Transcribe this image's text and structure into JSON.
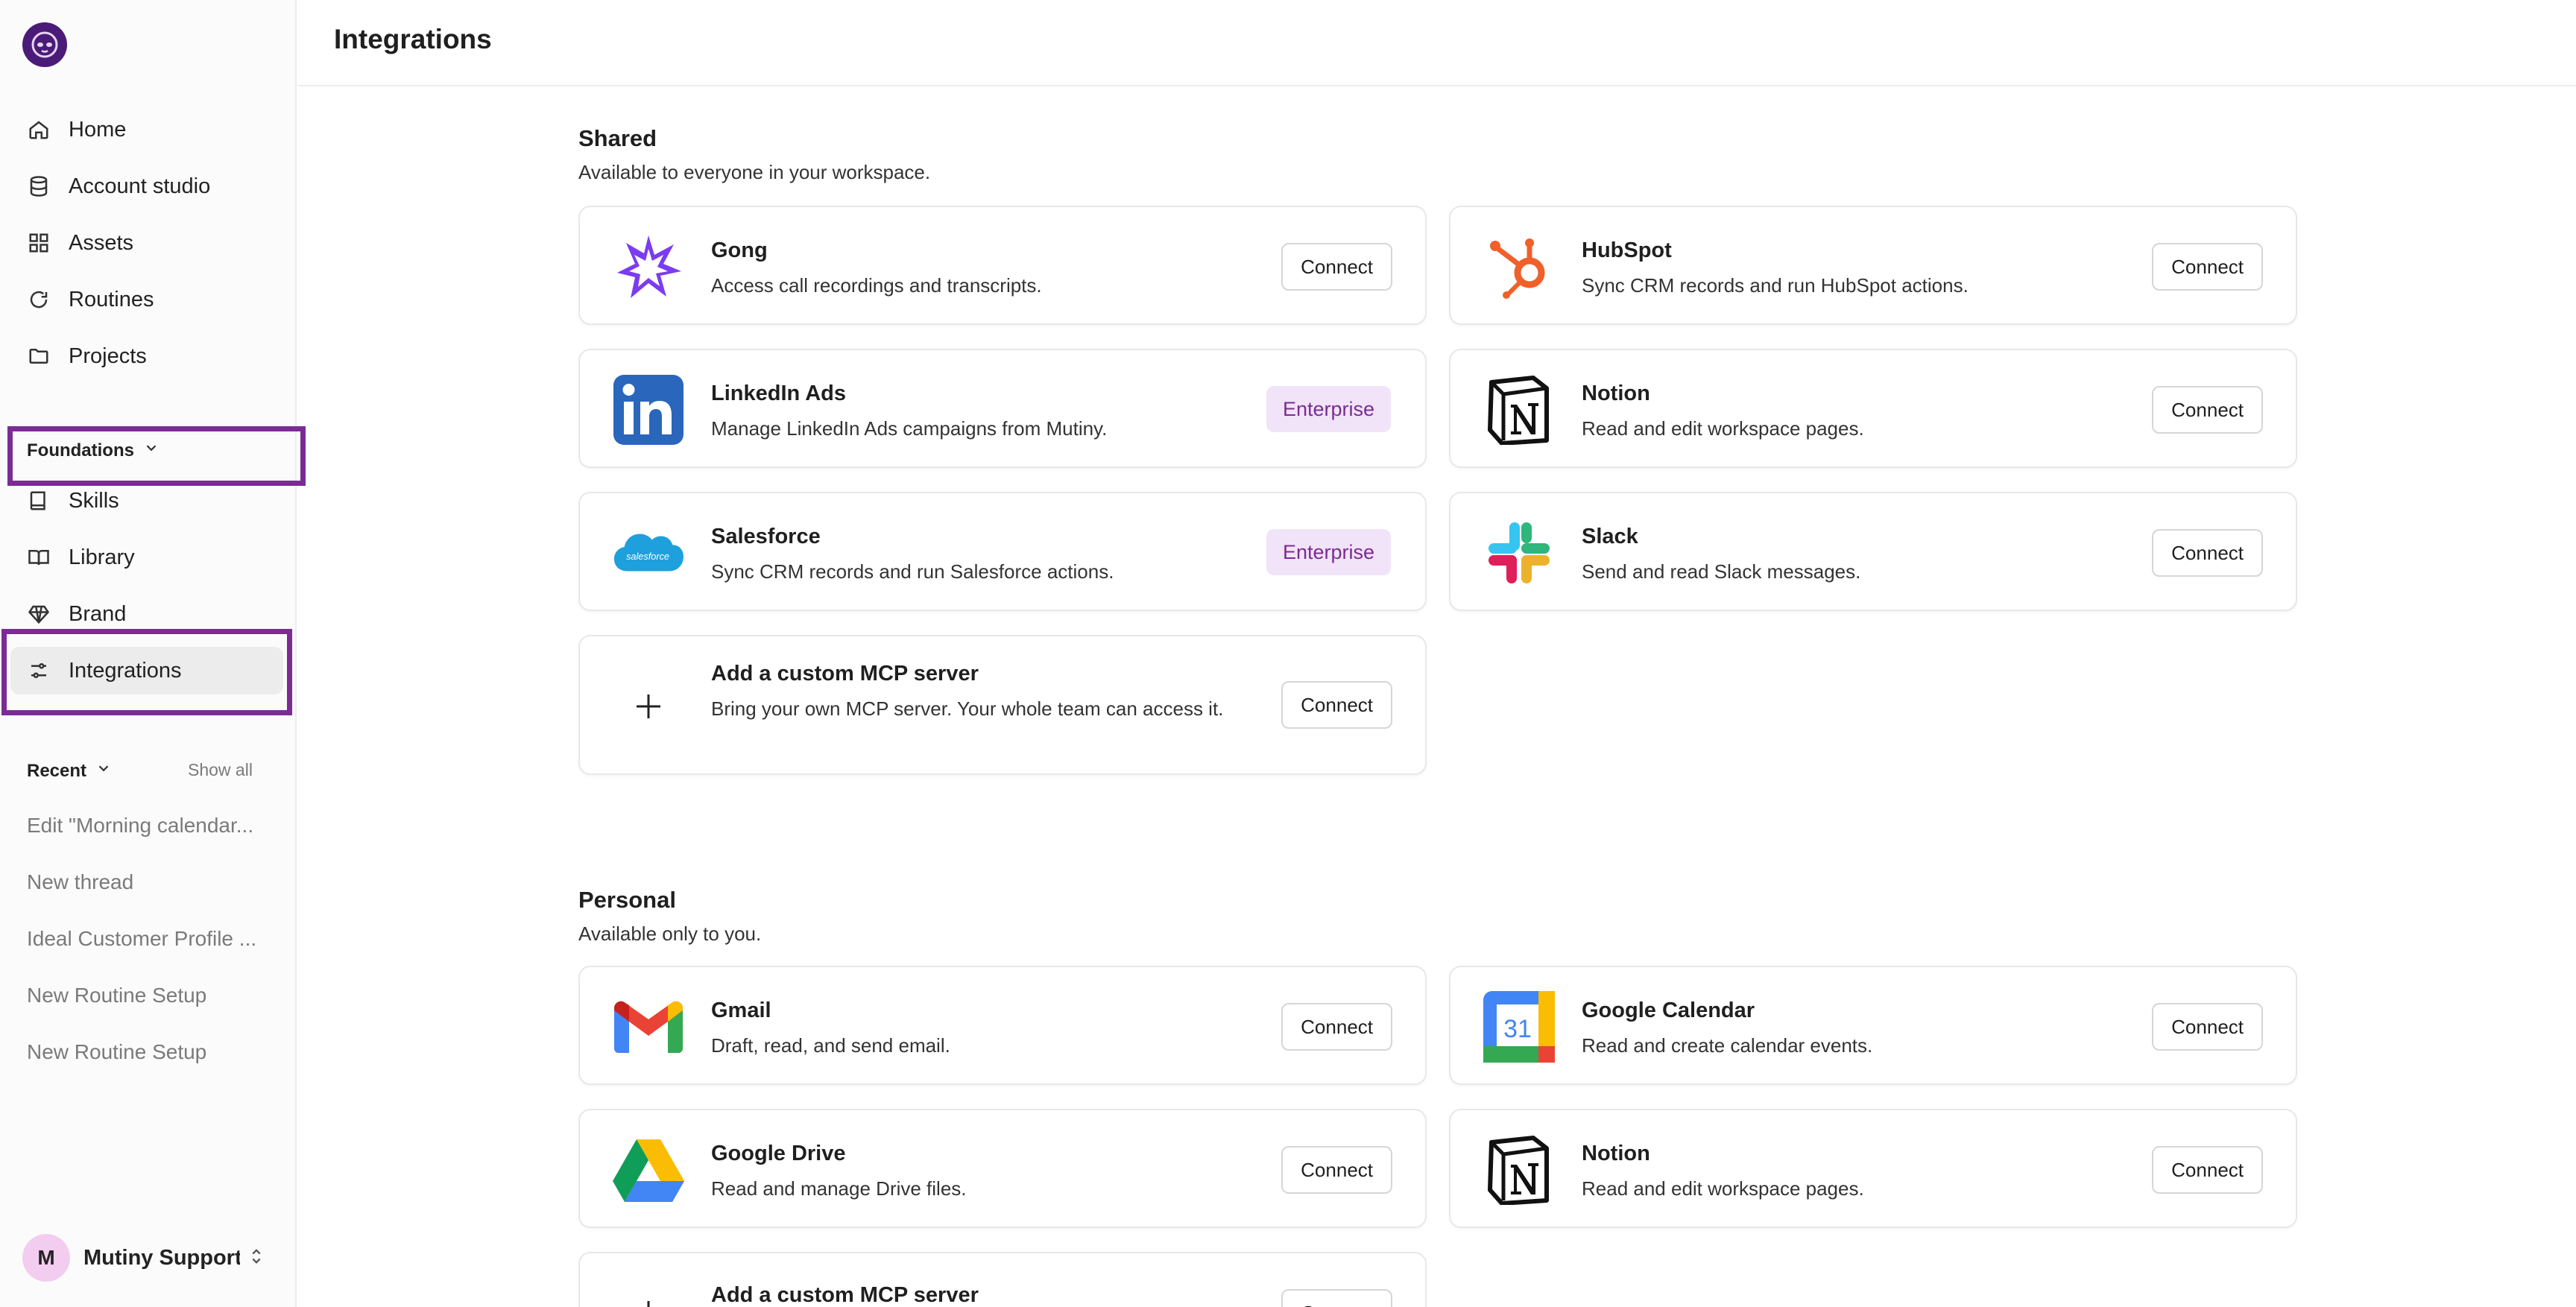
{
  "sidebar": {
    "nav": [
      {
        "label": "Home",
        "icon": "home-icon"
      },
      {
        "label": "Account studio",
        "icon": "database-icon"
      },
      {
        "label": "Assets",
        "icon": "grid-icon"
      },
      {
        "label": "Routines",
        "icon": "refresh-icon"
      },
      {
        "label": "Projects",
        "icon": "folder-icon"
      }
    ],
    "foundations": {
      "title": "Foundations",
      "items": [
        {
          "label": "Skills",
          "icon": "book-icon"
        },
        {
          "label": "Library",
          "icon": "open-book-icon"
        },
        {
          "label": "Brand",
          "icon": "diamond-icon"
        },
        {
          "label": "Integrations",
          "icon": "sliders-icon"
        }
      ]
    },
    "recent": {
      "title": "Recent",
      "show_all": "Show all",
      "items": [
        "Edit \"Morning calendar...",
        "New thread",
        "Ideal Customer Profile ...",
        "New Routine Setup",
        "New Routine Setup"
      ]
    },
    "user": {
      "initial": "M",
      "name": "Mutiny Support"
    }
  },
  "header": {
    "title": "Integrations"
  },
  "shared": {
    "title": "Shared",
    "subtitle": "Available to everyone in your workspace.",
    "cards": [
      {
        "name": "Gong",
        "desc": "Access call recordings and transcripts.",
        "action": "Connect"
      },
      {
        "name": "HubSpot",
        "desc": "Sync CRM records and run HubSpot actions.",
        "action": "Connect"
      },
      {
        "name": "LinkedIn Ads",
        "desc": "Manage LinkedIn Ads campaigns from Mutiny.",
        "action": "Enterprise"
      },
      {
        "name": "Notion",
        "desc": "Read and edit workspace pages.",
        "action": "Connect"
      },
      {
        "name": "Salesforce",
        "desc": "Sync CRM records and run Salesforce actions.",
        "action": "Enterprise"
      },
      {
        "name": "Slack",
        "desc": "Send and read Slack messages.",
        "action": "Connect"
      },
      {
        "name": "Add a custom MCP server",
        "desc": "Bring your own MCP server. Your whole team can access it.",
        "action": "Connect"
      }
    ]
  },
  "personal": {
    "title": "Personal",
    "subtitle": "Available only to you.",
    "cards": [
      {
        "name": "Gmail",
        "desc": "Draft, read, and send email.",
        "action": "Connect"
      },
      {
        "name": "Google Calendar",
        "desc": "Read and create calendar events.",
        "action": "Connect",
        "icon_text": "31"
      },
      {
        "name": "Google Drive",
        "desc": "Read and manage Drive files.",
        "action": "Connect"
      },
      {
        "name": "Notion",
        "desc": "Read and edit workspace pages.",
        "action": "Connect"
      },
      {
        "name": "Add a custom MCP server",
        "desc": "",
        "action": "Connect"
      }
    ]
  },
  "brand_logo_text": "salesforce",
  "colors": {
    "accent": "#7b2b94",
    "badge_bg": "#f1e4f8",
    "logo_bg": "#4a1c78"
  }
}
